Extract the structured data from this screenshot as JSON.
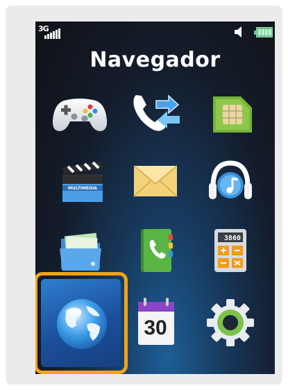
{
  "screen": {
    "title": "Navegador",
    "status_bar": {
      "network": "3G",
      "signal_icon": "signal-bars-icon",
      "sound_icon": "speaker-icon",
      "battery_icon": "battery-icon"
    },
    "selected_item": "browser",
    "accent_color": "#f2a21a",
    "grid": [
      {
        "id": "games",
        "icon": "gamepad-icon"
      },
      {
        "id": "call-log",
        "icon": "phone-arrows-icon"
      },
      {
        "id": "sim-card",
        "icon": "sim-card-icon"
      },
      {
        "id": "multimedia",
        "icon": "clapperboard-icon",
        "icon_text": "MULTIMEDIA"
      },
      {
        "id": "messages",
        "icon": "envelope-icon"
      },
      {
        "id": "music",
        "icon": "headphones-icon"
      },
      {
        "id": "files",
        "icon": "folder-icon"
      },
      {
        "id": "contacts",
        "icon": "phonebook-icon"
      },
      {
        "id": "calculator",
        "icon": "calculator-icon",
        "icon_text": "3860"
      },
      {
        "id": "browser",
        "icon": "globe-icon"
      },
      {
        "id": "calendar",
        "icon": "calendar-icon",
        "icon_text": "30"
      },
      {
        "id": "settings",
        "icon": "gear-icon"
      }
    ]
  }
}
